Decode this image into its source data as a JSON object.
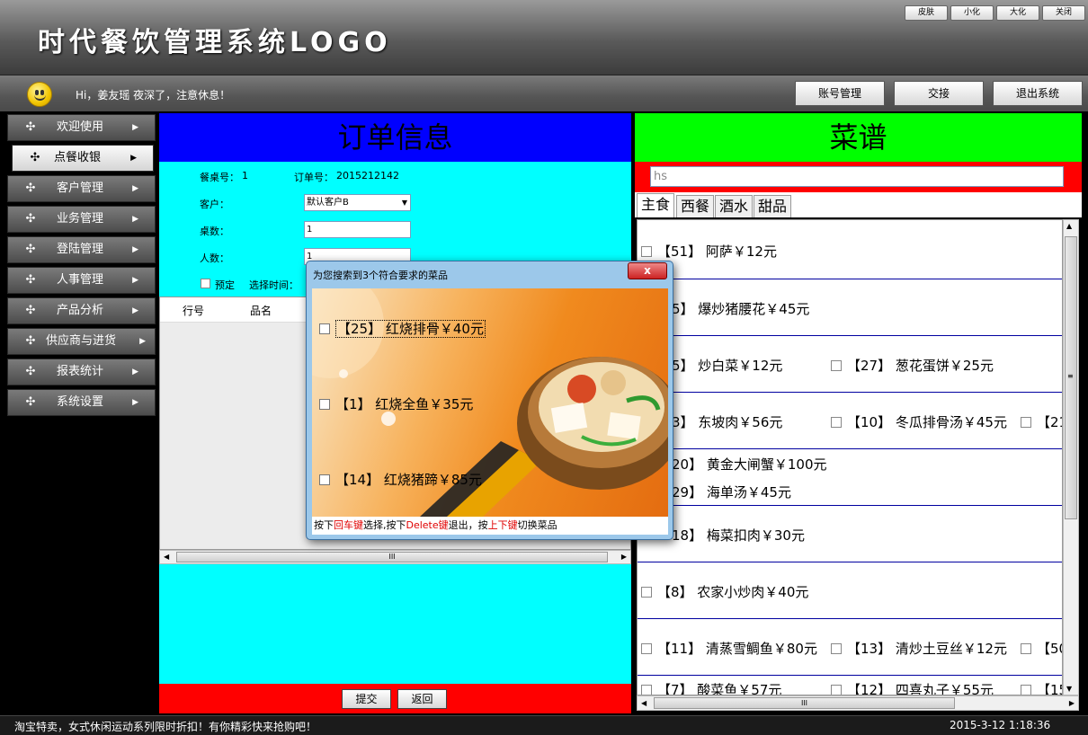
{
  "app": {
    "title": "时代餐饮管理系统LOGO",
    "window_buttons": [
      "皮肤",
      "小化",
      "大化",
      "关闭"
    ]
  },
  "header": {
    "greeting": "Hi，姜友瑶  夜深了，注意休息！",
    "buttons": [
      "账号管理",
      "交接",
      "退出系统"
    ]
  },
  "sidebar": {
    "items": [
      {
        "label": "欢迎使用"
      },
      {
        "label": "点餐收银"
      },
      {
        "label": "客户管理"
      },
      {
        "label": "业务管理"
      },
      {
        "label": "登陆管理"
      },
      {
        "label": "人事管理"
      },
      {
        "label": "产品分析"
      },
      {
        "label": "供应商与进货"
      },
      {
        "label": "报表统计"
      },
      {
        "label": "系统设置"
      }
    ],
    "active_index": 1
  },
  "order": {
    "title": "订单信息",
    "table_no_label": "餐桌号：",
    "table_no_value": "1",
    "order_no_label": "订单号：",
    "order_no_value": "2015212142",
    "customer_label": "客户：",
    "customer_value": "默认客户B",
    "tables_label": "桌数：",
    "tables_value": "1",
    "people_label": "人数：",
    "people_value": "1",
    "reserve_label": "预定",
    "time_label": "选择时间：",
    "columns": [
      "行号",
      "品名"
    ],
    "submit_label": "提交",
    "back_label": "返回"
  },
  "menu": {
    "title": "菜谱",
    "search_value": "hs",
    "tabs": [
      "主食",
      "西餐",
      "酒水",
      "甜品"
    ],
    "active_tab": 0,
    "rows": [
      [
        "【51】 阿萨￥12元"
      ],
      [
        "5】 爆炒猪腰花￥45元"
      ],
      [
        "5】 炒白菜￥12元",
        "【27】 葱花蛋饼￥25元"
      ],
      [
        "3】 东坡肉￥56元",
        "【10】 冬瓜排骨汤￥45元",
        "【21"
      ],
      [
        "20】 黄金大闸蟹￥100元",
        "29】 海单汤￥45元"
      ],
      [
        "18】 梅菜扣肉￥30元"
      ],
      [
        "【8】 农家小炒肉￥40元"
      ],
      [
        "【11】 清蒸雪鲷鱼￥80元",
        "【13】 清炒土豆丝￥12元",
        "【50"
      ],
      [
        "【7】 酸菜鱼￥57元",
        "【12】 四喜丸子￥55元",
        "【15"
      ]
    ]
  },
  "popup": {
    "title": "为您搜索到3个符合要求的菜品",
    "close_label": "x",
    "items": [
      "【25】 红烧排骨￥40元",
      "【1】 红烧全鱼￥35元",
      "【14】 红烧猪蹄￥85元"
    ],
    "hint_prefix": "按下",
    "hint_enter": "回车键",
    "hint_mid1": "选择,按下",
    "hint_delete": "Delete键",
    "hint_mid2": "退出，按",
    "hint_updown": "上下键",
    "hint_suffix": "切换菜品"
  },
  "status": {
    "ticker": "淘宝特卖，女式休闲运动系列限时折扣！有你精彩快来抢购吧！",
    "clock": "2015-3-12 1:18:36"
  },
  "icons": {
    "nav": "move-arrows-icon",
    "arrow": "triangle-right-icon",
    "smiley": "smiley-icon"
  }
}
